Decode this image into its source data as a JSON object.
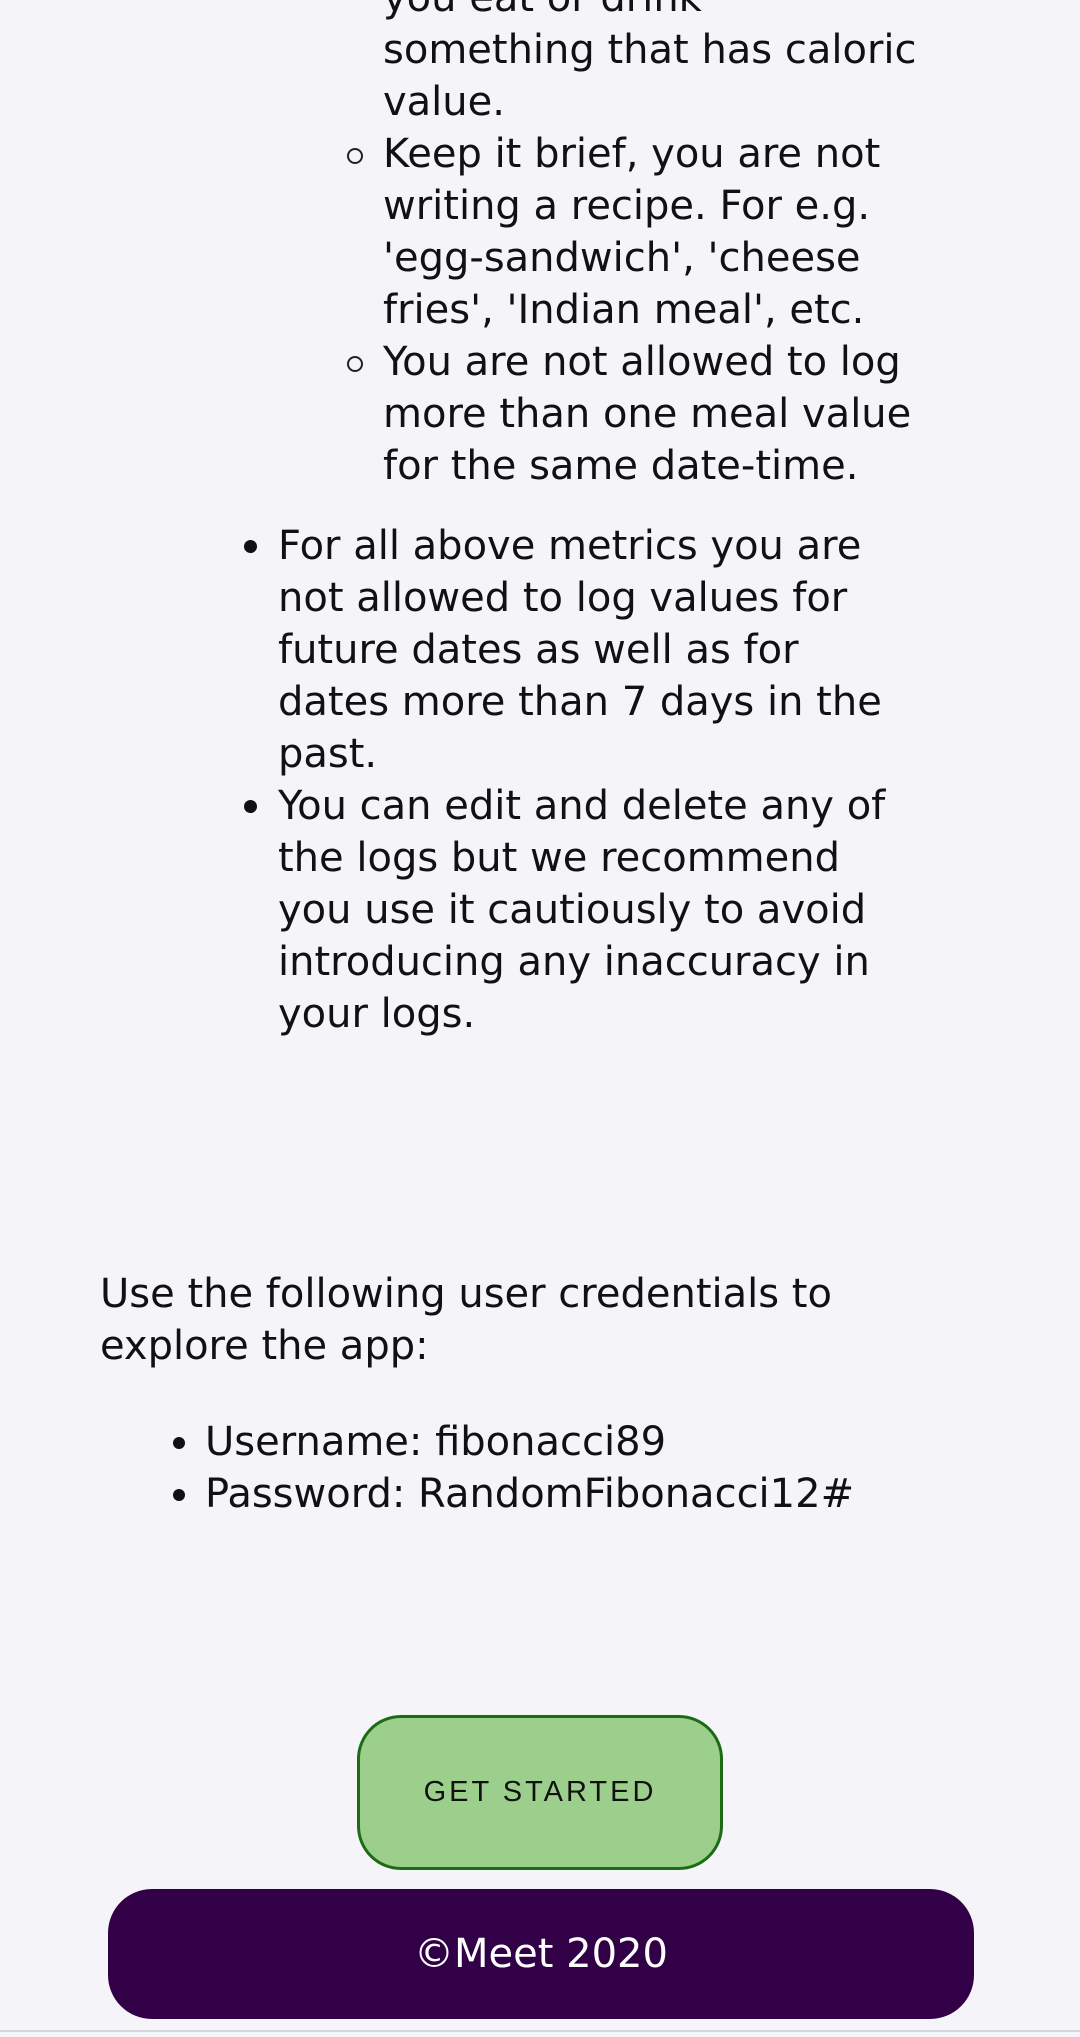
{
  "instructions": {
    "meal_sub_items": [
      "you eat or drink something that has caloric value.",
      "Keep it brief, you are not writing a recipe. For e.g. 'egg-sandwich', 'cheese fries', 'Indian meal', etc.",
      "You are not allowed to log more than one meal value for the same date-time."
    ],
    "general_items": [
      "For all above metrics you are not allowed to log values for future dates as well as for dates more than 7 days in the past.",
      "You can edit and delete any of the logs but we recommend you use it cautiously to avoid introducing any inaccuracy in your logs."
    ]
  },
  "credentials": {
    "intro": "Use the following user credentials to explore the app:",
    "username": "Username: fibonacci89",
    "password": "Password: RandomFibonacci12#"
  },
  "cta": {
    "label": "GET STARTED"
  },
  "footer": {
    "text": "©Meet 2020"
  },
  "colors": {
    "background": "#f5f5f9",
    "button_fill": "#9ccf8c",
    "button_border": "#1d6b14",
    "footer_bg": "#310046"
  }
}
